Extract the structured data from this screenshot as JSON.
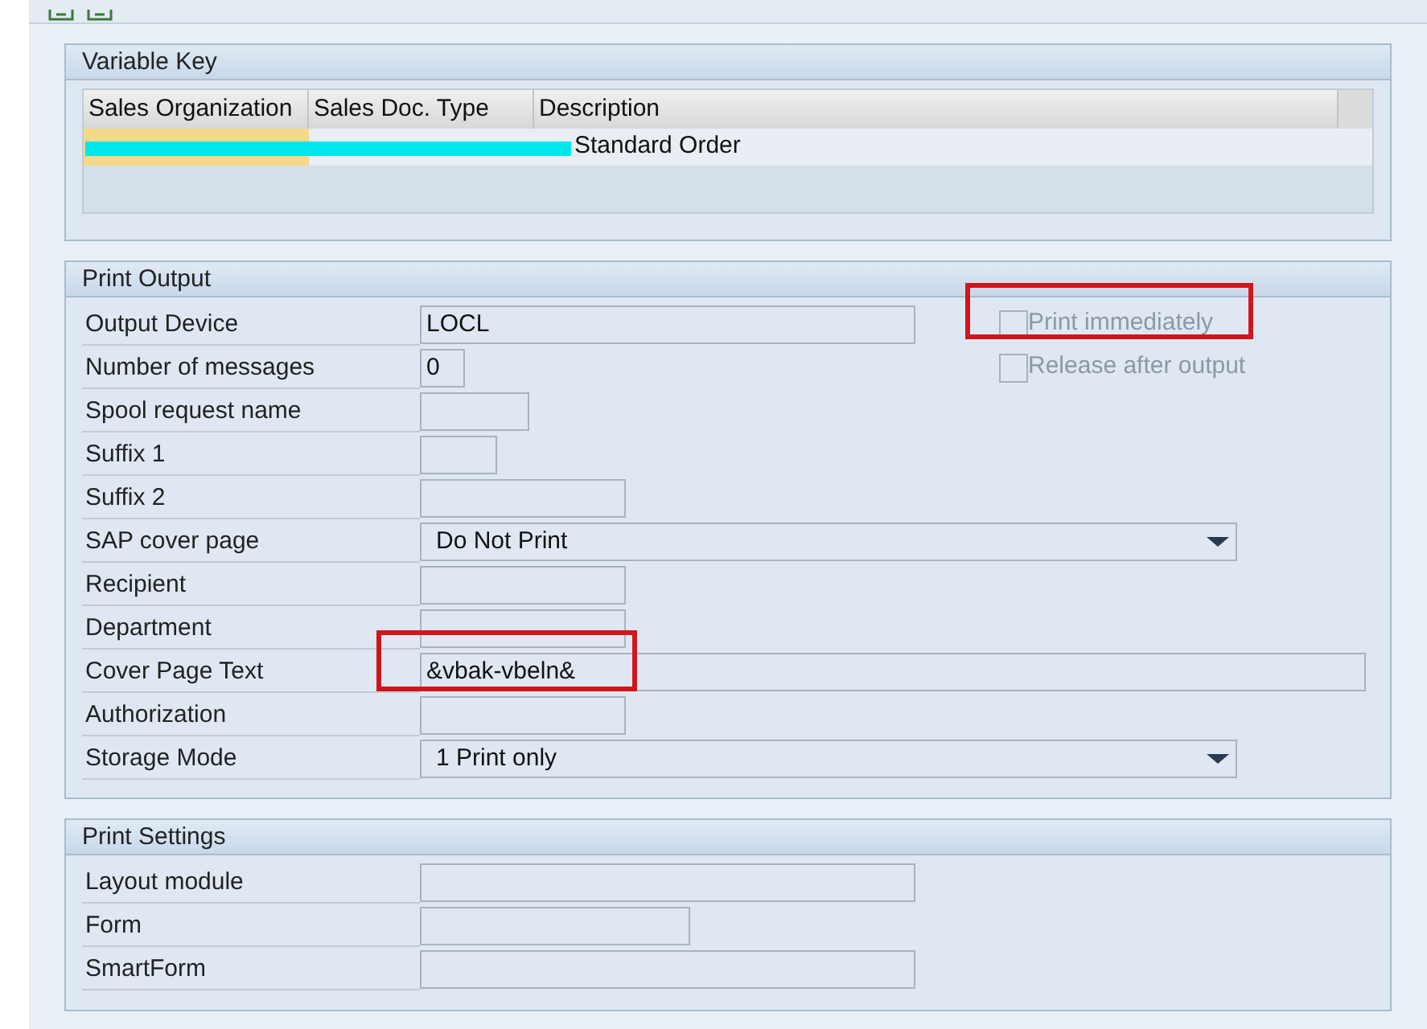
{
  "variable_key": {
    "title": "Variable Key",
    "columns": [
      "Sales Organization",
      "Sales Doc. Type",
      "Description"
    ],
    "rows": [
      {
        "selected": true,
        "redacted": true,
        "cells": [
          null,
          null,
          "Standard Order"
        ]
      }
    ]
  },
  "print_output": {
    "title": "Print Output",
    "fields": [
      {
        "label": "Output Device",
        "kind": "input",
        "value": "LOCL"
      },
      {
        "label": "Number of messages",
        "kind": "input",
        "value": "0"
      },
      {
        "label": "Spool request name",
        "kind": "input"
      },
      {
        "label": "Suffix 1",
        "kind": "input"
      },
      {
        "label": "Suffix 2",
        "kind": "input"
      },
      {
        "label": "SAP cover page",
        "kind": "dropdown",
        "value": "Do Not Print"
      },
      {
        "label": "Recipient",
        "kind": "input"
      },
      {
        "label": "Department",
        "kind": "input"
      },
      {
        "label": "Cover Page Text",
        "kind": "input",
        "value": "&vbak-vbeln&",
        "highlighted": true
      },
      {
        "label": "Authorization",
        "kind": "input"
      },
      {
        "label": "Storage Mode",
        "kind": "dropdown",
        "value": "1 Print only"
      }
    ],
    "checkboxes": [
      {
        "label": "Print immediately",
        "checked": false,
        "disabled": true,
        "highlighted": true
      },
      {
        "label": "Release after output",
        "checked": false,
        "disabled": true,
        "highlighted": false
      }
    ]
  },
  "print_settings": {
    "title": "Print Settings",
    "fields": [
      {
        "label": "Layout module",
        "kind": "input"
      },
      {
        "label": "Form",
        "kind": "input"
      },
      {
        "label": "SmartForm",
        "kind": "input"
      }
    ]
  }
}
